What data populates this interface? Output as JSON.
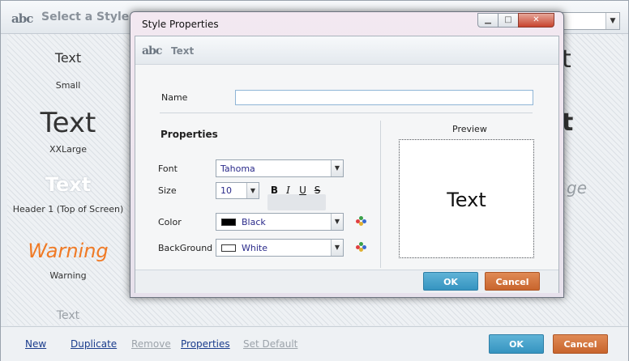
{
  "background": {
    "title": "Select a Style",
    "logo_text": "abc",
    "styles": [
      {
        "sample": "Text",
        "name": "Small"
      },
      {
        "sample": "Text",
        "name": "XXLarge"
      },
      {
        "sample": "Text",
        "name": "Header 1 (Top of Screen)"
      },
      {
        "sample": "Warning",
        "name": "Warning"
      },
      {
        "sample": "Text",
        "name": ""
      }
    ],
    "partial_samples": [
      "t",
      "t",
      "ge"
    ],
    "footer": {
      "links": [
        {
          "label": "New",
          "enabled": true
        },
        {
          "label": "Duplicate",
          "enabled": true
        },
        {
          "label": "Remove",
          "enabled": false
        },
        {
          "label": "Properties",
          "enabled": true
        },
        {
          "label": "Set Default",
          "enabled": false
        }
      ],
      "ok_label": "OK",
      "cancel_label": "Cancel"
    }
  },
  "dialog": {
    "title": "Style Properties",
    "subheader_logo": "abc",
    "subheader_title": "Text",
    "name_label": "Name",
    "name_value": "",
    "properties_title": "Properties",
    "font_label": "Font",
    "font_value": "Tahoma",
    "size_label": "Size",
    "size_value": "10",
    "format_buttons": {
      "bold": "B",
      "italic": "I",
      "underline": "U",
      "strike": "S"
    },
    "color_label": "Color",
    "color_value": "Black",
    "color_swatch": "#000000",
    "background_label": "BackGround",
    "background_value": "White",
    "background_swatch": "#ffffff",
    "preview_label": "Preview",
    "preview_text": "Text",
    "ok_label": "OK",
    "cancel_label": "Cancel"
  },
  "colors": {
    "ok_button": "#3d9bc7",
    "cancel_button": "#cf6b33",
    "warning_orange": "#f07a25",
    "link_blue": "#1a3c8c"
  }
}
